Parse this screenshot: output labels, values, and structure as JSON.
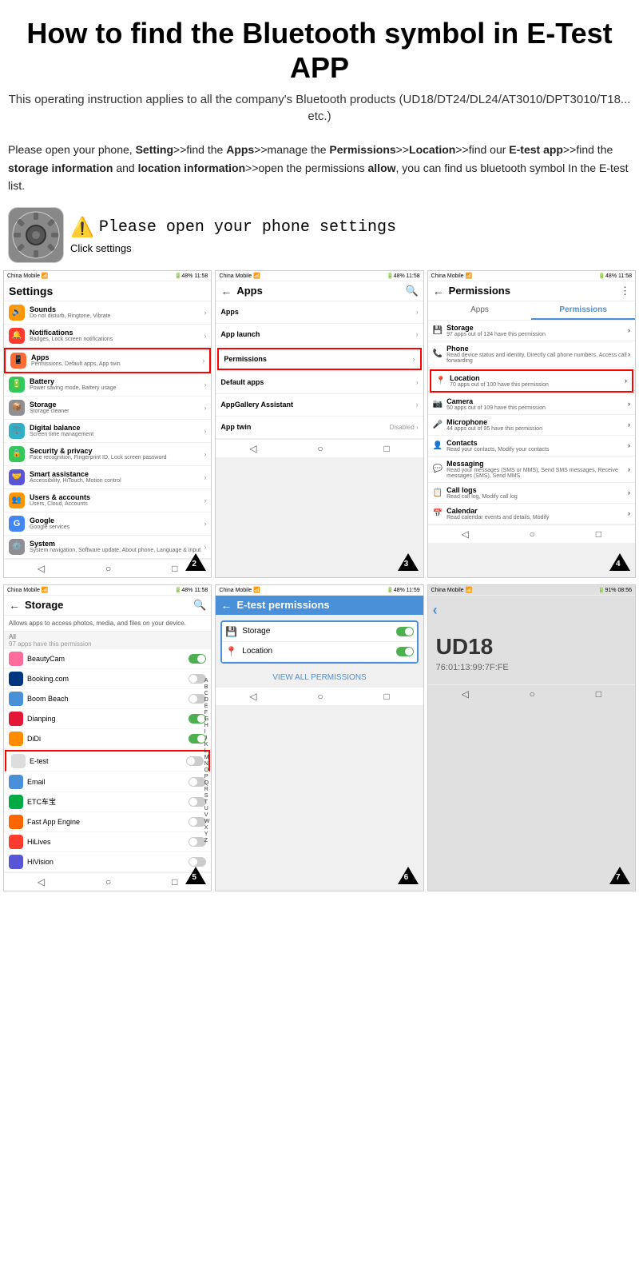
{
  "title": "How to find the Bluetooth symbol\nin E-Test APP",
  "subtitle": "This operating instruction applies to all the company's Bluetooth products\n(UD18/DT24/DL24/AT3010/DPT3010/T18... etc.)",
  "instruction": "Please open your phone, Setting>>find the Apps>>manage the Permissions>>Location>>find our E-test app>>find the storage information and location information>>open the permissions allow, you can find us bluetooth symbol In the E-test list.",
  "step1_text": "Please open your phone settings",
  "click_settings": "Click settings",
  "screen1": {
    "status": "China Mobile  48%  11:58",
    "title": "Settings",
    "items": [
      {
        "icon": "🔊",
        "color": "#FF9500",
        "title": "Sounds",
        "subtitle": "Do not disturb, Ringtone, Vibrate"
      },
      {
        "icon": "🔔",
        "color": "#FF3B30",
        "title": "Notifications",
        "subtitle": "Badges, Lock screen notifications"
      },
      {
        "icon": "📱",
        "color": "#FF6B35",
        "title": "Apps",
        "subtitle": "Permissions, Default apps, App twin",
        "highlight": true
      },
      {
        "icon": "🔋",
        "color": "#34C759",
        "title": "Battery",
        "subtitle": "Power saving mode, Battery usage"
      },
      {
        "icon": "📦",
        "color": "#8E8E93",
        "title": "Storage",
        "subtitle": "Storage cleaner"
      },
      {
        "icon": "⚖️",
        "color": "#30B0C7",
        "title": "Digital balance",
        "subtitle": "Screen time management"
      },
      {
        "icon": "🔒",
        "color": "#34C759",
        "title": "Security & privacy",
        "subtitle": "Face recognition, Fingerprint ID, Lock screen password"
      },
      {
        "icon": "🤝",
        "color": "#5856D6",
        "title": "Smart assistance",
        "subtitle": "Accessibility, HiTouch, Motion control"
      },
      {
        "icon": "👥",
        "color": "#FF9500",
        "title": "Users & accounts",
        "subtitle": "Users, Cloud, Accounts"
      },
      {
        "icon": "G",
        "color": "#4285F4",
        "title": "Google",
        "subtitle": "Google services"
      },
      {
        "icon": "⚙️",
        "color": "#8E8E93",
        "title": "System",
        "subtitle": "System navigation, Software update, About phone, Language & input"
      }
    ]
  },
  "screen2": {
    "status": "China Mobile  48%  11:58",
    "title": "Apps",
    "items": [
      {
        "title": "Apps",
        "chevron": true
      },
      {
        "title": "App launch",
        "chevron": true
      },
      {
        "title": "Permissions",
        "chevron": true,
        "highlight": true
      },
      {
        "title": "Default apps",
        "chevron": true
      },
      {
        "title": "AppGallery Assistant",
        "chevron": true
      },
      {
        "title": "App twin",
        "value": "Disabled"
      }
    ]
  },
  "screen3": {
    "status": "China Mobile  48%  11:58",
    "title": "Permissions",
    "tabs": [
      "Apps",
      "Permissions"
    ],
    "active_tab": "Permissions",
    "items": [
      {
        "icon": "💾",
        "title": "Storage",
        "subtitle": "97 apps out of 124 have this permission"
      },
      {
        "icon": "📞",
        "title": "Phone",
        "subtitle": "Read device status and identity, Directly call phone numbers, Access call forwarding"
      },
      {
        "icon": "📍",
        "title": "Location",
        "subtitle": "70 apps out of 100 have this permission",
        "highlight": true
      },
      {
        "icon": "📷",
        "title": "Camera",
        "subtitle": "50 apps out of 109 have this permission"
      },
      {
        "icon": "🎤",
        "title": "Microphone",
        "subtitle": "44 apps out of 95 have this permission"
      },
      {
        "icon": "👤",
        "title": "Contacts",
        "subtitle": "Read your contacts, Modify your contacts"
      },
      {
        "icon": "💬",
        "title": "Messaging",
        "subtitle": "Read your messages (SMS or MMS), Send SMS messages, Receive messages (SMS), Send MMS"
      },
      {
        "icon": "📋",
        "title": "Call logs",
        "subtitle": "Read call log, Modify call log"
      },
      {
        "icon": "📅",
        "title": "Calendar",
        "subtitle": "Read calendar events and details, Modify"
      }
    ]
  },
  "screen4": {
    "status": "China Mobile  48%  11:58",
    "title": "Storage",
    "header_text": "Allows apps to access photos, media, and files on your device.",
    "section": "All",
    "section_sub": "97 apps have this permission",
    "apps": [
      {
        "name": "BeautyCam",
        "color": "#FF6B9D",
        "toggle": true
      },
      {
        "name": "Booking.com",
        "color": "#003580",
        "toggle": false
      },
      {
        "name": "Boom Beach",
        "color": "#4A90D9",
        "toggle": false
      },
      {
        "name": "Dianping",
        "color": "#E31837",
        "toggle": true
      },
      {
        "name": "DiDi",
        "color": "#FF8C00",
        "toggle": true
      },
      {
        "name": "E-test",
        "color": "#ccc",
        "toggle": false,
        "highlight": true
      },
      {
        "name": "Email",
        "color": "#4A90D9",
        "toggle": false
      },
      {
        "name": "ETC车宝",
        "color": "#00AA44",
        "toggle": false
      },
      {
        "name": "Fast App Engine",
        "color": "#FF6600",
        "toggle": false
      },
      {
        "name": "HiLives",
        "color": "#FF3B30",
        "toggle": false
      },
      {
        "name": "HiVision",
        "color": "#5856D6",
        "toggle": false
      }
    ]
  },
  "screen5": {
    "status": "China Mobile  48%  11:59",
    "title": "E-test permissions",
    "items": [
      {
        "icon": "💾",
        "label": "Storage",
        "toggle": true
      },
      {
        "icon": "📍",
        "label": "Location",
        "toggle": true
      }
    ],
    "view_all": "VIEW ALL PERMISSIONS"
  },
  "screen6": {
    "status": "China Mobile  91%  08:56",
    "device_name": "UD18",
    "device_mac": "76:01:13:99:7F:FE"
  },
  "alpha_index": [
    "A",
    "B",
    "C",
    "D",
    "E",
    "F",
    "G",
    "H",
    "I",
    "J",
    "K",
    "L",
    "M",
    "N",
    "O",
    "P",
    "Q",
    "R",
    "S",
    "T",
    "U",
    "V",
    "W",
    "X",
    "Y",
    "Z"
  ]
}
